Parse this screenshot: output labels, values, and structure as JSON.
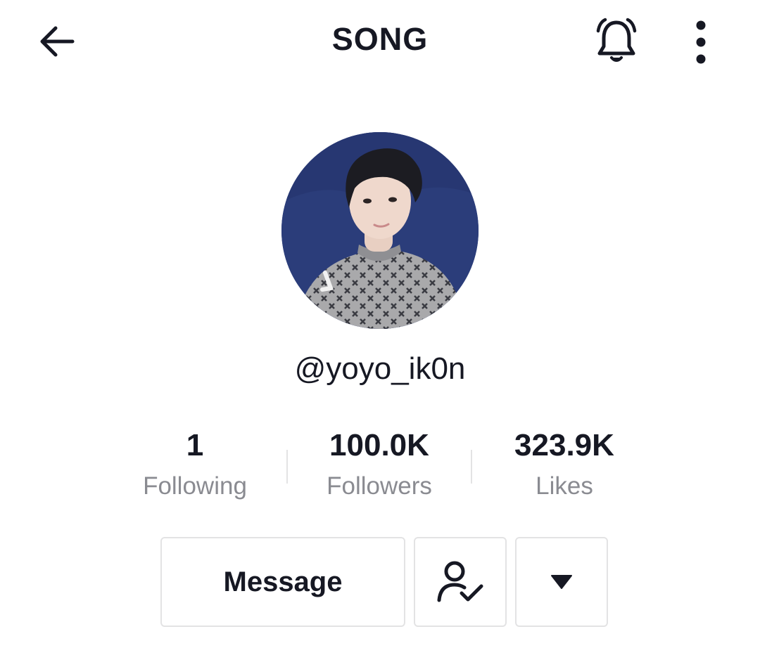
{
  "header": {
    "title": "SONG",
    "back_icon": "arrow-left-icon",
    "bell_icon": "bell-icon",
    "more_icon": "more-vertical-icon"
  },
  "profile": {
    "avatar_description": "profile-photo",
    "username": "@yoyo_ik0n"
  },
  "stats": [
    {
      "value": "1",
      "label": "Following"
    },
    {
      "value": "100.0K",
      "label": "Followers"
    },
    {
      "value": "323.9K",
      "label": "Likes"
    }
  ],
  "actions": {
    "message_label": "Message",
    "friend_icon": "user-check-icon",
    "dropdown_icon": "caret-down-icon"
  },
  "colors": {
    "text_primary": "#161823",
    "text_secondary": "#8a8b91",
    "border": "#e3e3e4",
    "avatar_bg": "#2a3c78"
  }
}
